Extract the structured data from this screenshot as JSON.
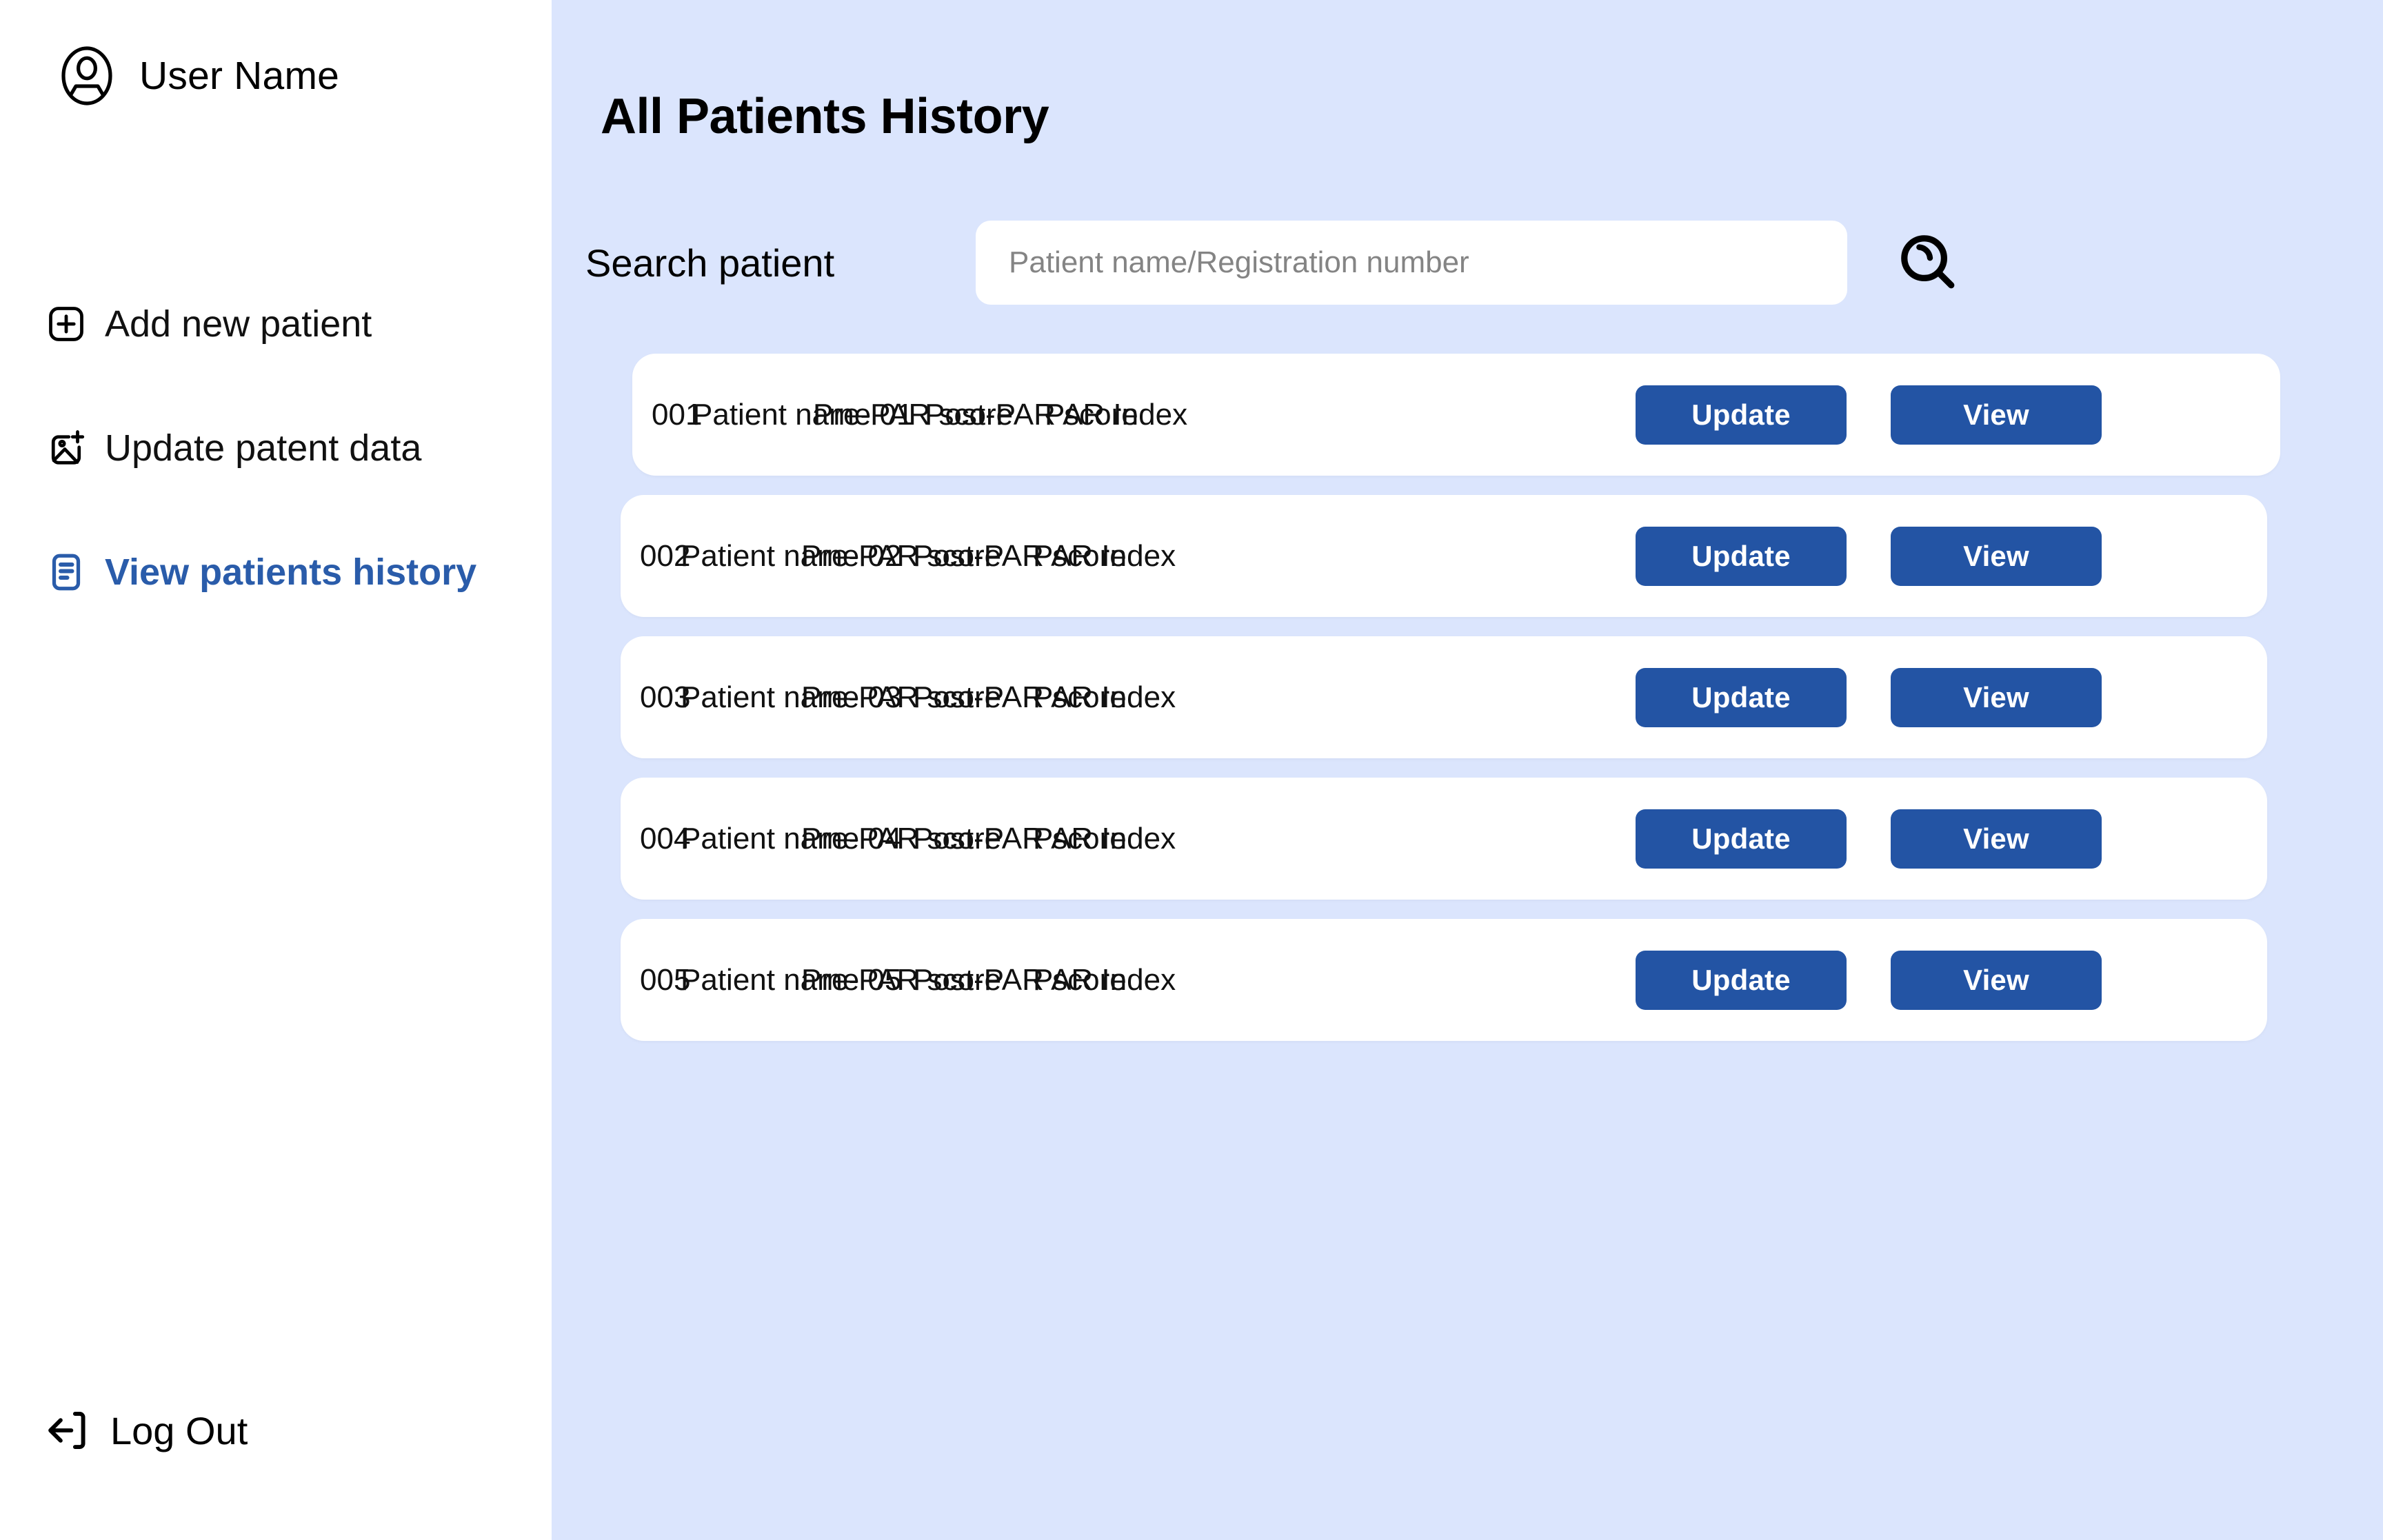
{
  "theme": {
    "sidebar_bg": "#ffffff",
    "main_bg": "#dbe5fd",
    "accent_blue": "#2354a4",
    "active_nav_blue": "#2a5caa",
    "row_bg": "#ffffff",
    "placeholder_gray": "#848484"
  },
  "sidebar": {
    "user": {
      "name": "User Name",
      "icon": "user-circle-icon"
    },
    "items": [
      {
        "label": "Add new patient",
        "icon": "add-square-icon",
        "active": false
      },
      {
        "label": "Update patent data",
        "icon": "image-plus-icon",
        "active": false
      },
      {
        "label": "View patients history",
        "icon": "document-list-icon",
        "active": true
      }
    ],
    "logout": {
      "label": "Log Out",
      "icon": "logout-arrow-icon"
    }
  },
  "main": {
    "title": "All Patients History",
    "search": {
      "label": "Search patient",
      "placeholder": "Patient name/Registration number",
      "value": "",
      "button_icon": "search-icon"
    },
    "buttons": {
      "update_label": "Update",
      "view_label": "View"
    },
    "rows": [
      {
        "id": "001",
        "name": "Patient name 01",
        "pre": "Pre-PAR score",
        "post": "Post-PAR score",
        "index": "PAR Index"
      },
      {
        "id": "002",
        "name": "Patient name 02",
        "pre": "Pre-PAR score",
        "post": "Post-PAR score",
        "index": "PAR Index"
      },
      {
        "id": "003",
        "name": "Patient name 03",
        "pre": "Pre-PAR score",
        "post": "Post-PAR score",
        "index": "PAR Index"
      },
      {
        "id": "004",
        "name": "Patient name 04",
        "pre": "Pre-PAR score",
        "post": "Post-PAR score",
        "index": "PAR Index"
      },
      {
        "id": "005",
        "name": "Patient name 05",
        "pre": "Pre-PAR score",
        "post": "Post-PAR score",
        "index": "PAR Index"
      }
    ]
  }
}
